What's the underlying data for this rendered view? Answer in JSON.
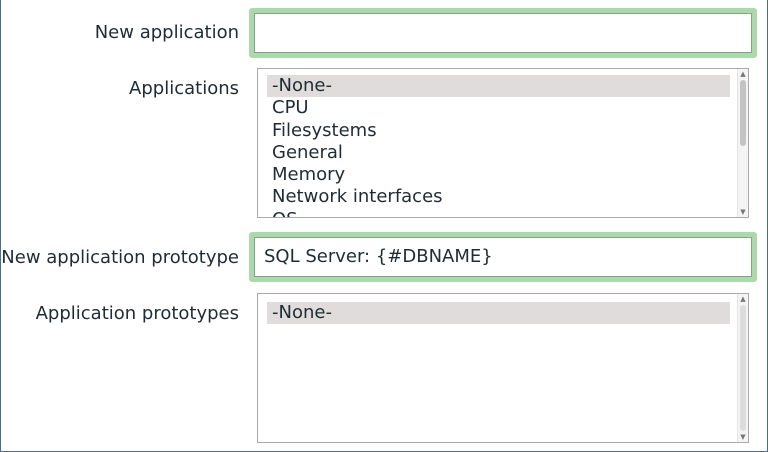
{
  "form": {
    "new_application": {
      "label": "New application",
      "value": ""
    },
    "applications": {
      "label": "Applications",
      "options": [
        "-None-",
        "CPU",
        "Filesystems",
        "General",
        "Memory",
        "Network interfaces",
        "OS"
      ],
      "selected": "-None-"
    },
    "new_application_prototype": {
      "label": "New application prototype",
      "value": "SQL Server: {#DBNAME}"
    },
    "application_prototypes": {
      "label": "Application prototypes",
      "options": [
        "-None-"
      ],
      "selected": "-None-"
    }
  },
  "icons": {
    "scroll_up": "chevron-up-icon",
    "scroll_down": "chevron-down-icon"
  },
  "colors": {
    "focus_glow": "#acd8ac",
    "selected_option": "#e0dcdc",
    "frame_border": "#4a6f8a"
  }
}
